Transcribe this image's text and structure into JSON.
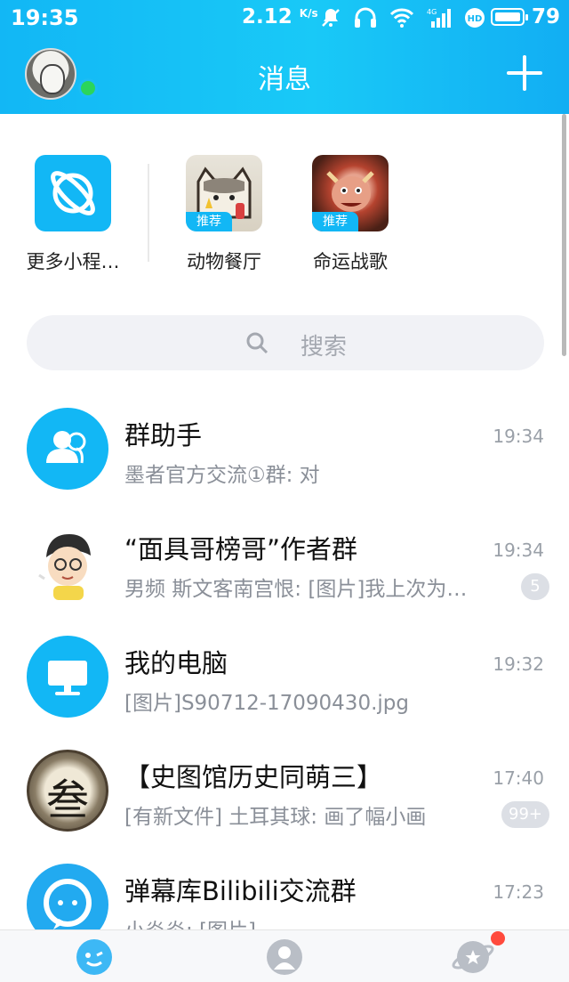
{
  "status_bar": {
    "time": "19:35",
    "speed": "2.12",
    "speed_unit": "K/s",
    "network": "4G",
    "battery": "79"
  },
  "header": {
    "title": "消息"
  },
  "mini_apps": [
    {
      "label": "更多小程…",
      "icon": "planet-icon"
    },
    {
      "label": "动物餐厅",
      "tag": "推荐",
      "icon": "cat-game-icon"
    },
    {
      "label": "命运战歌",
      "tag": "推荐",
      "icon": "warrior-game-icon"
    }
  ],
  "search": {
    "placeholder": "搜索"
  },
  "chats": [
    {
      "name": "群助手",
      "message": "墨者官方交流①群: 对",
      "time": "19:34",
      "badge": ""
    },
    {
      "name": "“面具哥榜哥”作者群",
      "message": "男频 斯文客南宫恨: [图片]我上次为…",
      "time": "19:34",
      "badge": "5"
    },
    {
      "name": "我的电脑",
      "message": "[图片]S90712-17090430.jpg",
      "time": "19:32",
      "badge": ""
    },
    {
      "name": "【史图馆历史同萌三】",
      "message": "[有新文件] 土耳其球: 画了幅小画",
      "time": "17:40",
      "badge": "99+",
      "avatar_char": "叁"
    },
    {
      "name": "弹幕库Bilibili交流群",
      "message": "小炎炎: [图片]",
      "time": "17:23",
      "badge": ""
    }
  ],
  "tabbar": {
    "items": [
      "message-tab-icon",
      "contacts-tab-icon",
      "explore-tab-icon"
    ]
  },
  "colors": {
    "accent": "#12b7f5",
    "online": "#2bd55b",
    "notify": "#ff4a3d"
  }
}
